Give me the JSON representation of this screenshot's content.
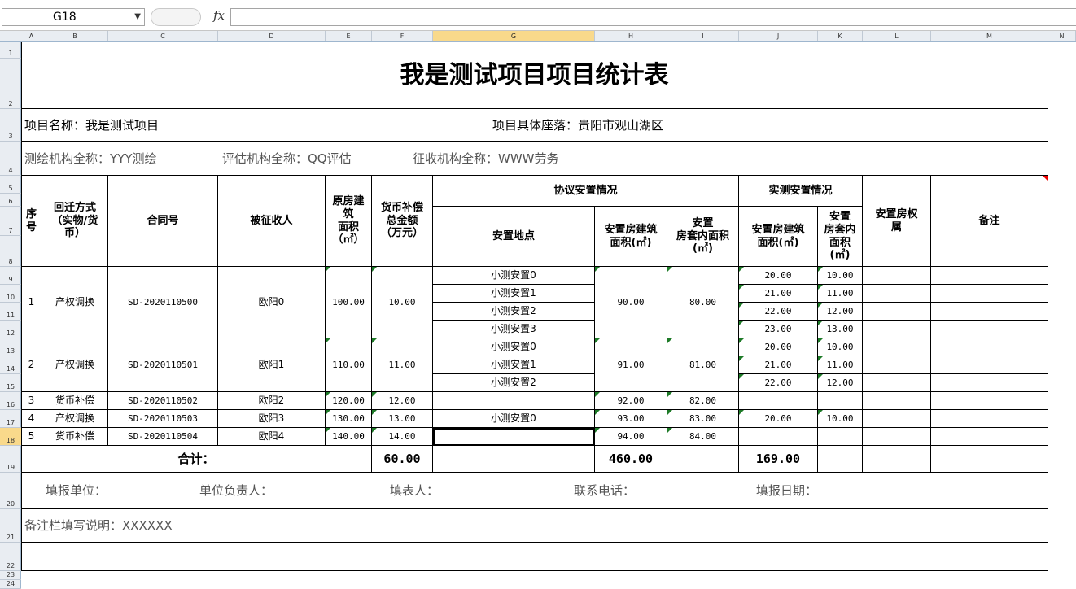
{
  "formula_bar": {
    "cell_ref": "G18",
    "fx_label": "fx",
    "formula": ""
  },
  "columns": [
    "A",
    "B",
    "C",
    "D",
    "E",
    "F",
    "G",
    "H",
    "I",
    "J",
    "K",
    "L",
    "M",
    "N"
  ],
  "selected_column": "G",
  "rows": [
    "1",
    "2",
    "3",
    "4",
    "5",
    "6",
    "7",
    "8",
    "9",
    "10",
    "11",
    "12",
    "13",
    "14",
    "15",
    "16",
    "17",
    "18",
    "19",
    "20",
    "21",
    "22",
    "23",
    "24"
  ],
  "selected_row": "18",
  "sheet": {
    "title": "我是测试项目项目统计表",
    "project_name": "项目名称：我是测试项目",
    "project_location": "项目具体座落：贵阳市观山湖区",
    "org_survey": "测绘机构全称：YYY测绘",
    "org_assess": "评估机构全称：QQ评估",
    "org_collect": "征收机构全称：WWW劳务",
    "headers": {
      "seq": "序\n号",
      "method": "回迁方式\n（实物/货\n币）",
      "contract": "合同号",
      "person": "被征收人",
      "orig_area": "原房建\n筑\n面积\n（㎡）",
      "money": "货币补偿\n总金额\n（万元）",
      "agreed": "协议安置情况",
      "location": "安置地点",
      "agreed_build": "安置房建筑\n面积(㎡)",
      "agreed_inner": "安置\n房套内面积\n(㎡)",
      "actual": "实测安置情况",
      "actual_build": "安置房建筑\n面积(㎡)",
      "actual_inner": "安置\n房套内\n面积\n(㎡)",
      "ownership": "安置房权\n属",
      "remark": "备注"
    },
    "records": [
      {
        "seq": "1",
        "method": "产权调换",
        "contract": "SD-2020110500",
        "person": "欧阳0",
        "orig_area": "100.00",
        "money": "10.00",
        "agreed_build": "90.00",
        "agreed_inner": "80.00",
        "locations": [
          "小测安置0",
          "小测安置1",
          "小测安置2",
          "小测安置3"
        ],
        "actual_build": [
          "20.00",
          "21.00",
          "22.00",
          "23.00"
        ],
        "actual_inner": [
          "10.00",
          "11.00",
          "12.00",
          "13.00"
        ]
      },
      {
        "seq": "2",
        "method": "产权调换",
        "contract": "SD-2020110501",
        "person": "欧阳1",
        "orig_area": "110.00",
        "money": "11.00",
        "agreed_build": "91.00",
        "agreed_inner": "81.00",
        "locations": [
          "小测安置0",
          "小测安置1",
          "小测安置2"
        ],
        "actual_build": [
          "20.00",
          "21.00",
          "22.00"
        ],
        "actual_inner": [
          "10.00",
          "11.00",
          "12.00"
        ]
      },
      {
        "seq": "3",
        "method": "货币补偿",
        "contract": "SD-2020110502",
        "person": "欧阳2",
        "orig_area": "120.00",
        "money": "12.00",
        "agreed_build": "92.00",
        "agreed_inner": "82.00",
        "locations": [
          ""
        ],
        "actual_build": [
          ""
        ],
        "actual_inner": [
          ""
        ]
      },
      {
        "seq": "4",
        "method": "产权调换",
        "contract": "SD-2020110503",
        "person": "欧阳3",
        "orig_area": "130.00",
        "money": "13.00",
        "agreed_build": "93.00",
        "agreed_inner": "83.00",
        "locations": [
          "小测安置0"
        ],
        "actual_build": [
          "20.00"
        ],
        "actual_inner": [
          "10.00"
        ]
      },
      {
        "seq": "5",
        "method": "货币补偿",
        "contract": "SD-2020110504",
        "person": "欧阳4",
        "orig_area": "140.00",
        "money": "14.00",
        "agreed_build": "94.00",
        "agreed_inner": "84.00",
        "locations": [
          ""
        ],
        "actual_build": [
          ""
        ],
        "actual_inner": [
          ""
        ]
      }
    ],
    "total_label": "合计：",
    "total_money": "60.00",
    "total_agreed_build": "460.00",
    "total_actual_build": "169.00",
    "footer": {
      "unit": "填报单位：",
      "leader": "单位负责人：",
      "filler": "填表人：",
      "phone": "联系电话：",
      "date": "填报日期："
    },
    "note": "备注栏填写说明：XXXXXX"
  }
}
